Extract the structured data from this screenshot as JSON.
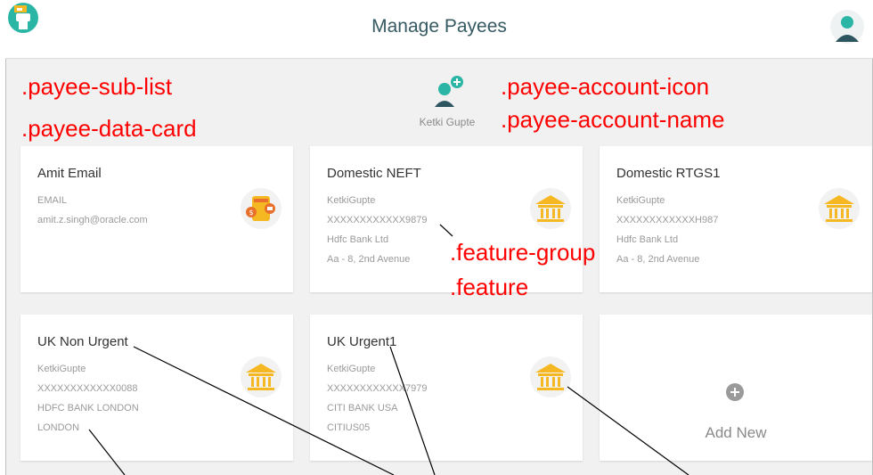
{
  "header": {
    "title": "Manage Payees"
  },
  "payee_account": {
    "name": "Ketki Gupte"
  },
  "annotations": {
    "sub_list": ".payee-sub-list",
    "data_card": ".payee-data-card",
    "account_icon": ".payee-account-icon",
    "account_name": ".payee-account-name",
    "feature_group": ".feature-group",
    "feature": ".feature"
  },
  "cards": [
    {
      "title": "Amit Email",
      "lines": [
        "EMAIL",
        "amit.z.singh@oracle.com"
      ],
      "icon": "email-wallet-icon"
    },
    {
      "title": "Domestic NEFT",
      "lines": [
        "KetkiGupte",
        "XXXXXXXXXXXX9879",
        "Hdfc Bank Ltd",
        "Aa - 8, 2nd Avenue"
      ],
      "icon": "bank-icon"
    },
    {
      "title": "Domestic RTGS1",
      "lines": [
        "KetkiGupte",
        "XXXXXXXXXXXXH987",
        "Hdfc Bank Ltd",
        "Aa - 8, 2nd Avenue"
      ],
      "icon": "bank-icon"
    },
    {
      "title": "UK Non Urgent",
      "lines": [
        "KetkiGupte",
        "XXXXXXXXXXXX0088",
        "HDFC BANK LONDON",
        "LONDON"
      ],
      "icon": "bank-icon"
    },
    {
      "title": "UK Urgent1",
      "lines": [
        "KetkiGupte",
        "XXXXXXXXXXXX7979",
        "CITI BANK USA",
        "CITIUS05"
      ],
      "icon": "bank-icon"
    }
  ],
  "add_new": {
    "label": "Add New",
    "icon": "plus-circle-icon"
  },
  "colors": {
    "accent": "#2bb5a5",
    "dark_teal": "#2d5560",
    "bank_yellow": "#f6b822",
    "annotation_red": "#ff0000",
    "background": "#f1f1f1"
  }
}
